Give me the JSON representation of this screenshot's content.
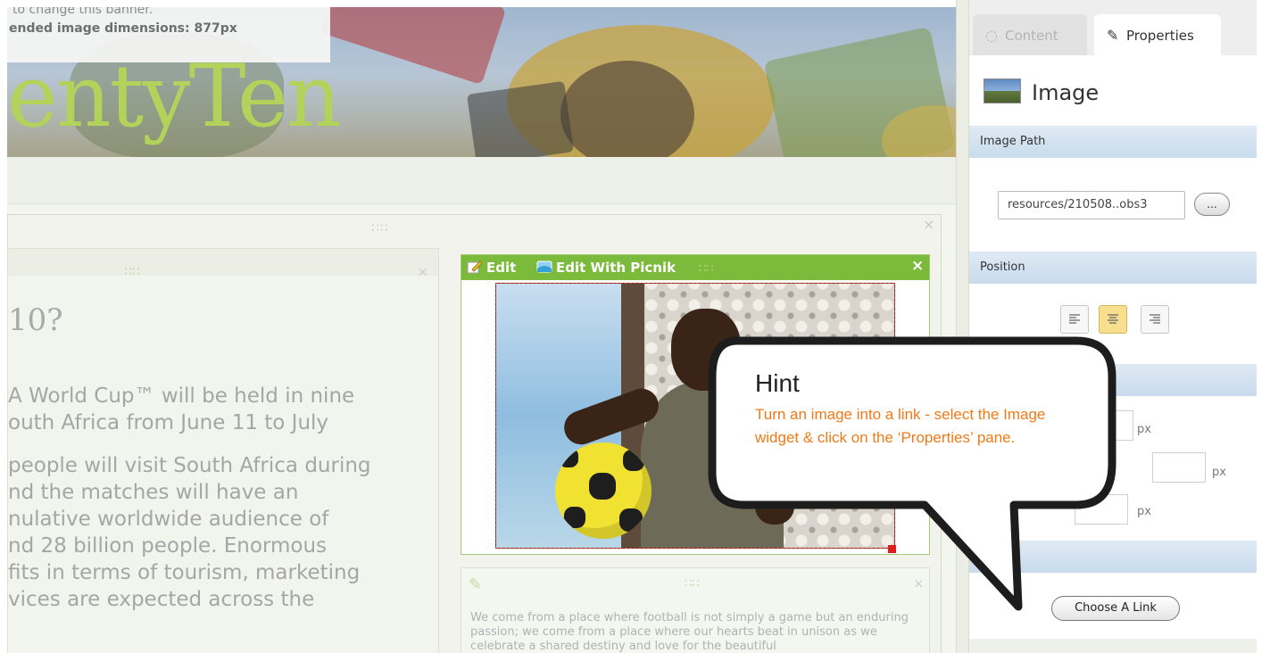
{
  "banner": {
    "title": "entyTen",
    "note_line1": "to change this banner.",
    "note_line2": "ended image dimensions: 877px"
  },
  "text_widget": {
    "heading": "10?",
    "paragraphs": [
      [
        "A World Cup™ will be held in nine",
        "outh Africa from June 11 to July"
      ],
      [
        "people will visit South Africa during",
        "nd the matches will have an",
        "nulative worldwide audience of",
        "nd 28 billion people. Enormous",
        "fits in terms of tourism, marketing",
        "vices are expected across the"
      ]
    ]
  },
  "image_widget": {
    "edit_label": "Edit",
    "edit_picnik_label": "Edit With Picnik",
    "close_glyph": "×"
  },
  "text_widget2": {
    "body": "We come from a place where football is not simply a game but an enduring passion; we come from a place where our hearts beat in unison as we celebrate a shared destiny and love for the beautiful"
  },
  "panel": {
    "tabs": [
      {
        "label": "Content",
        "active": false
      },
      {
        "label": "Properties",
        "active": true
      }
    ],
    "widget_title": "Image",
    "sections": {
      "image_path": "Image Path",
      "position": "Position"
    },
    "image_path_value": "resources/210508..obs3",
    "browse_label": "...",
    "align_options": [
      "align-left",
      "align-center",
      "align-right"
    ],
    "align_selected": "align-center",
    "px_unit": "px",
    "choose_link_label": "Choose A Link"
  },
  "hint": {
    "title": "Hint",
    "text": "Turn an image into a link - select the Image widget & click on the ‘Properties’ pane."
  },
  "colors": {
    "toolbar_green": "#7cba3c",
    "hint_orange": "#f07a18",
    "section_blue": "#c9dbec",
    "align_active": "#f8df8e"
  }
}
